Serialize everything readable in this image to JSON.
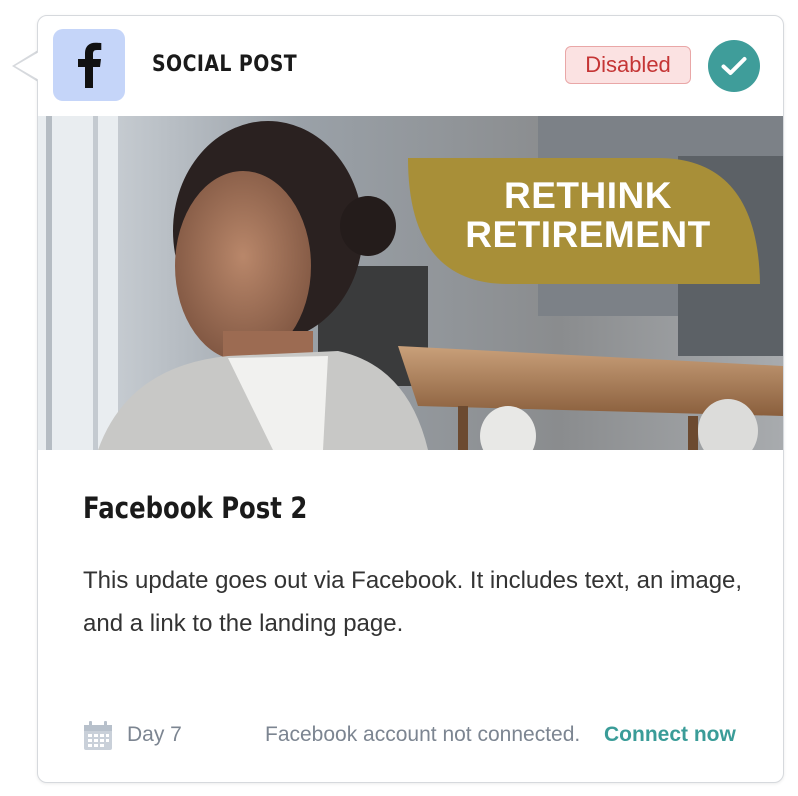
{
  "header": {
    "platform_icon": "facebook-f-icon",
    "type_label": "SOCIAL POST",
    "status": "Disabled",
    "check_icon": "checkmark-icon"
  },
  "image": {
    "promo_line1": "RETHINK",
    "promo_line2": "RETIREMENT"
  },
  "post": {
    "title": "Facebook Post 2",
    "description": "This update goes out via Facebook. It includes text, an image, and a link to the landing page."
  },
  "footer": {
    "calendar_icon": "calendar-icon",
    "day": "Day 7",
    "connection_note": "Facebook account not connected.",
    "connect_label": "Connect now"
  },
  "colors": {
    "badge_bg": "#c5d5f9",
    "status_bg": "#fbe2e2",
    "status_text": "#c53535",
    "accent_teal": "#3f9d9a",
    "promo_gold": "#a88f38"
  }
}
